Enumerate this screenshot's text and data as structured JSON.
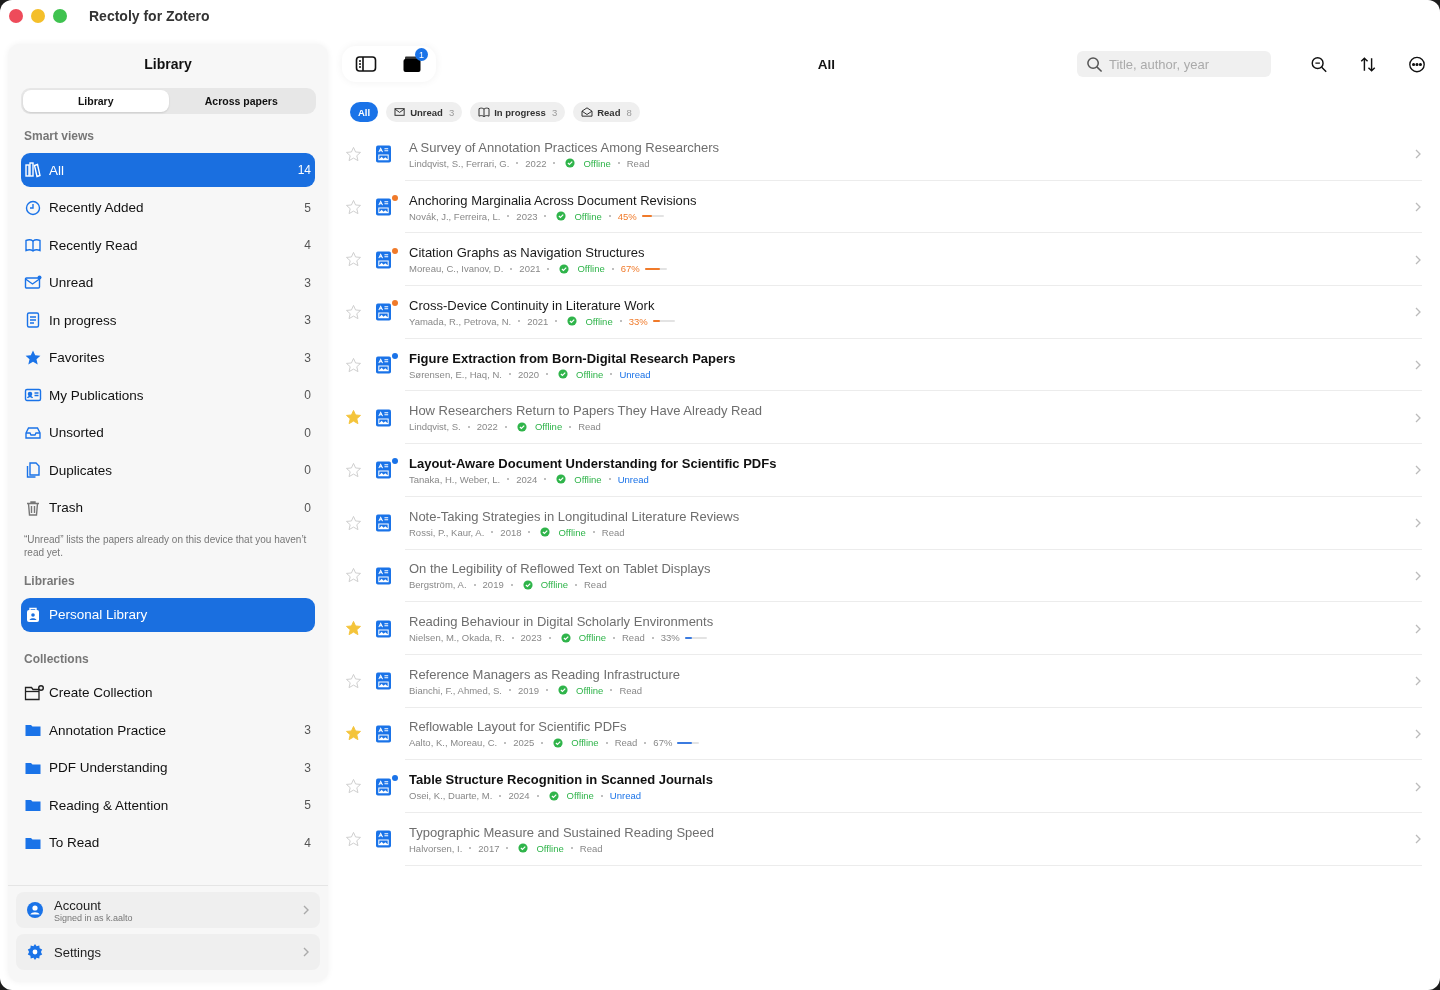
{
  "window": {
    "title": "Rectoly for Zotero"
  },
  "sidebar": {
    "title": "Library",
    "segments": [
      {
        "label": "Library",
        "selected": true
      },
      {
        "label": "Across papers",
        "selected": false
      }
    ],
    "smart_views_heading": "Smart views",
    "smart_views": [
      {
        "kind": "all",
        "label": "All",
        "count": "14",
        "selected": true
      },
      {
        "kind": "recently_added",
        "label": "Recently Added",
        "count": "5",
        "selected": false
      },
      {
        "kind": "recently_read",
        "label": "Recently Read",
        "count": "4",
        "selected": false
      },
      {
        "kind": "unread",
        "label": "Unread",
        "count": "3",
        "selected": false
      },
      {
        "kind": "in_progress",
        "label": "In progress",
        "count": "3",
        "selected": false
      },
      {
        "kind": "favorites",
        "label": "Favorites",
        "count": "3",
        "selected": false
      },
      {
        "kind": "publications",
        "label": "My Publications",
        "count": "0",
        "selected": false
      },
      {
        "kind": "unsorted",
        "label": "Unsorted",
        "count": "0",
        "selected": false
      },
      {
        "kind": "duplicates",
        "label": "Duplicates",
        "count": "0",
        "selected": false
      },
      {
        "kind": "trash",
        "label": "Trash",
        "count": "0",
        "selected": false
      }
    ],
    "note": "“Unread” lists the papers already on this device that you haven’t read yet.",
    "libraries_heading": "Libraries",
    "libraries": [
      {
        "label": "Personal Library",
        "selected": true
      }
    ],
    "collections_heading": "Collections",
    "collections": [
      {
        "kind": "create",
        "label": "Create Collection"
      },
      {
        "kind": "collection",
        "label": "Annotation Practice",
        "count": "3"
      },
      {
        "kind": "collection",
        "label": "PDF Understanding",
        "count": "3"
      },
      {
        "kind": "collection",
        "label": "Reading & Attention",
        "count": "5"
      },
      {
        "kind": "collection",
        "label": "To Read",
        "count": "4"
      }
    ],
    "account": {
      "label": "Account",
      "detail": "Signed in as k.aalto"
    },
    "settings": {
      "label": "Settings"
    }
  },
  "toolbar": {
    "title": "All",
    "badge": "1",
    "search": {
      "placeholder": "Title, author, year"
    }
  },
  "filters": [
    {
      "label": "All",
      "selected": true
    },
    {
      "kind": "unread",
      "label": "Unread",
      "count": "3",
      "selected": false
    },
    {
      "kind": "in_progress",
      "label": "In progress",
      "count": "3",
      "selected": false
    },
    {
      "kind": "read",
      "label": "Read",
      "count": "8",
      "selected": false
    }
  ],
  "papers": [
    {
      "starred": false,
      "kind": "read",
      "title": "A Survey of Annotation Practices Among Researchers",
      "authors": "Lindqvist, S., Ferrari, G.",
      "year": "2022",
      "availability": "Offline",
      "status": "Read"
    },
    {
      "starred": false,
      "kind": "in_progress",
      "title": "Anchoring Marginalia Across Document Revisions",
      "authors": "Novák, J., Ferreira, L.",
      "year": "2023",
      "availability": "Offline",
      "progress": "45%",
      "level": 0.45
    },
    {
      "starred": false,
      "kind": "in_progress",
      "title": "Citation Graphs as Navigation Structures",
      "authors": "Moreau, C., Ivanov, D.",
      "year": "2021",
      "availability": "Offline",
      "progress": "67%",
      "level": 0.67
    },
    {
      "starred": false,
      "kind": "in_progress",
      "title": "Cross-Device Continuity in Literature Work",
      "authors": "Yamada, R., Petrova, N.",
      "year": "2021",
      "availability": "Offline",
      "progress": "33%",
      "level": 0.33
    },
    {
      "starred": false,
      "kind": "unread",
      "title": "Figure Extraction from Born-Digital Research Papers",
      "authors": "Sørensen, E., Haq, N.",
      "year": "2020",
      "availability": "Offline",
      "status": "Unread"
    },
    {
      "starred": true,
      "kind": "read",
      "title": "How Researchers Return to Papers They Have Already Read",
      "authors": "Lindqvist, S.",
      "year": "2022",
      "availability": "Offline",
      "status": "Read"
    },
    {
      "starred": false,
      "kind": "unread",
      "title": "Layout-Aware Document Understanding for Scientific PDFs",
      "authors": "Tanaka, H., Weber, L.",
      "year": "2024",
      "availability": "Offline",
      "status": "Unread"
    },
    {
      "starred": false,
      "kind": "read",
      "title": "Note-Taking Strategies in Longitudinal Literature Reviews",
      "authors": "Rossi, P., Kaur, A.",
      "year": "2018",
      "availability": "Offline",
      "status": "Read"
    },
    {
      "starred": false,
      "kind": "read",
      "title": "On the Legibility of Reflowed Text on Tablet Displays",
      "authors": "Bergström, A.",
      "year": "2019",
      "availability": "Offline",
      "status": "Read"
    },
    {
      "starred": true,
      "kind": "read",
      "title": "Reading Behaviour in Digital Scholarly Environments",
      "authors": "Nielsen, M., Okada, R.",
      "year": "2023",
      "availability": "Offline",
      "status": "Read",
      "progress": "33%",
      "level": 0.33
    },
    {
      "starred": false,
      "kind": "read",
      "title": "Reference Managers as Reading Infrastructure",
      "authors": "Bianchi, F., Ahmed, S.",
      "year": "2019",
      "availability": "Offline",
      "status": "Read"
    },
    {
      "starred": true,
      "kind": "read",
      "title": "Reflowable Layout for Scientific PDFs",
      "authors": "Aalto, K., Moreau, C.",
      "year": "2025",
      "availability": "Offline",
      "status": "Read",
      "progress": "67%",
      "level": 0.67
    },
    {
      "starred": false,
      "kind": "unread",
      "title": "Table Structure Recognition in Scanned Journals",
      "authors": "Osei, K., Duarte, M.",
      "year": "2024",
      "availability": "Offline",
      "status": "Unread"
    },
    {
      "starred": false,
      "kind": "read",
      "title": "Typographic Measure and Sustained Reading Speed",
      "authors": "Halvorsen, I.",
      "year": "2017",
      "availability": "Offline",
      "status": "Read"
    }
  ]
}
